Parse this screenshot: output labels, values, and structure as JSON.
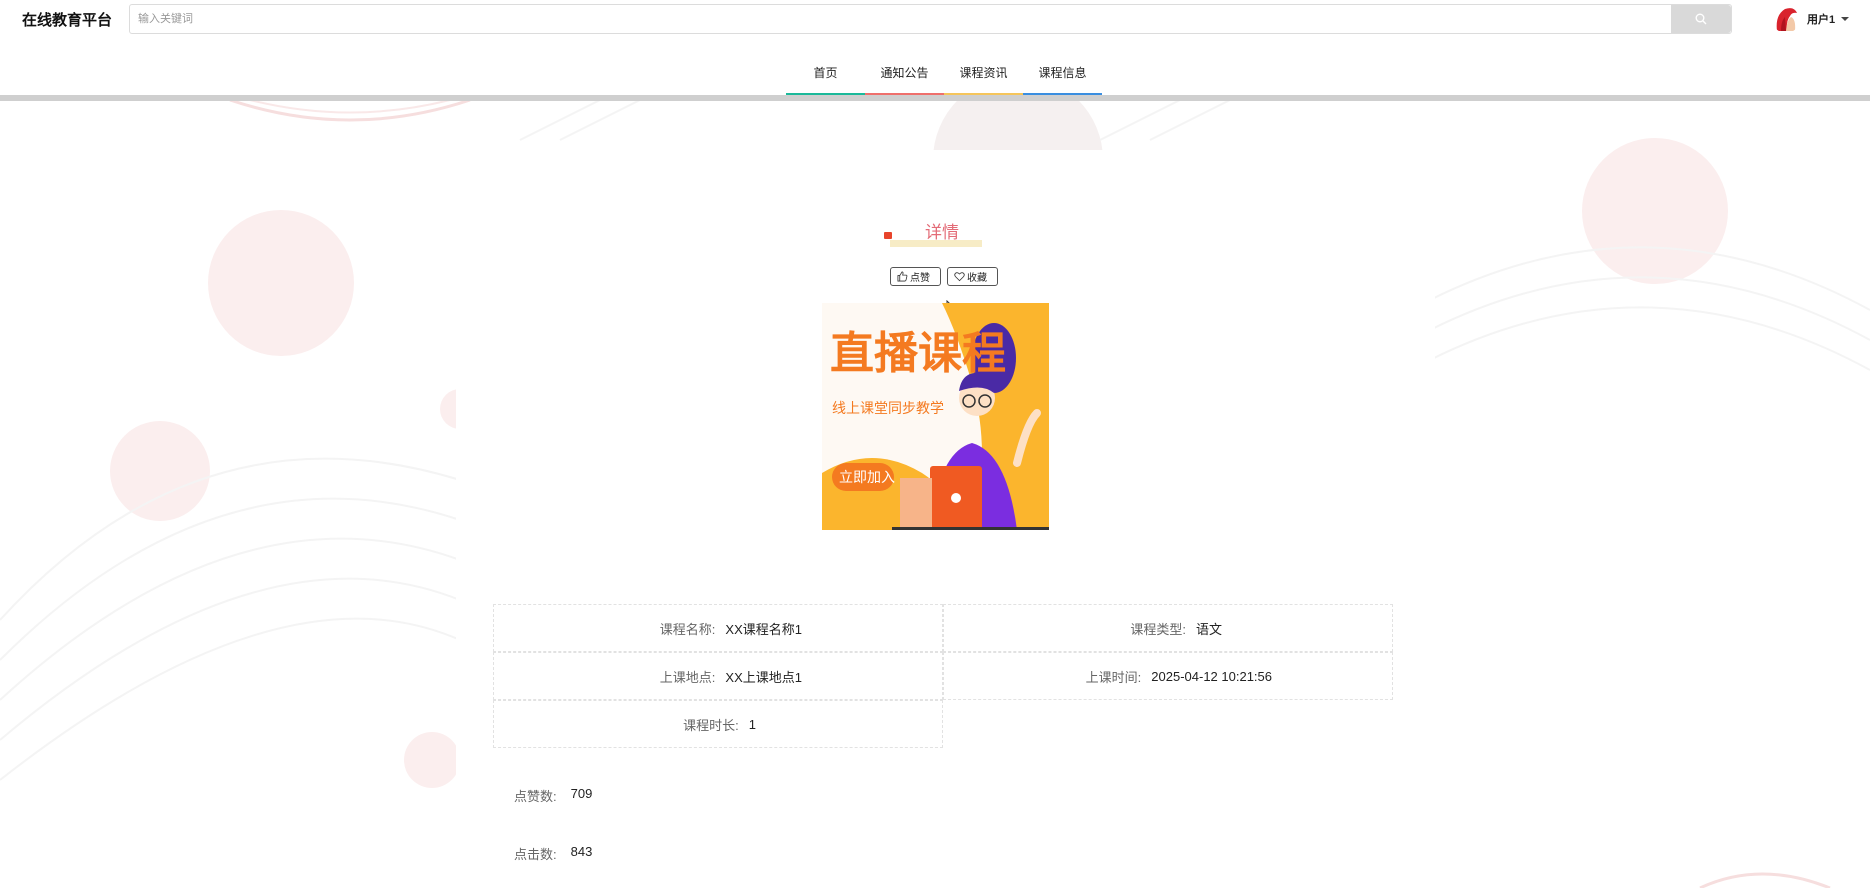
{
  "header": {
    "brand": "在线教育平台",
    "search_placeholder": "输入关键词",
    "search_value": "",
    "user_name": "用户1"
  },
  "nav": {
    "items": [
      {
        "label": "首页",
        "color": "#1bb99a"
      },
      {
        "label": "通知公告",
        "color": "#ef6f6c"
      },
      {
        "label": "课程资讯",
        "color": "#f5c55b"
      },
      {
        "label": "课程信息",
        "color": "#3a8ee0"
      }
    ]
  },
  "detail": {
    "title": "详情",
    "like_label": "点赞",
    "collect_label": "收藏"
  },
  "poster": {
    "heading": "直播课程",
    "subheading": "线上课堂同步教学",
    "cta": "立即加入",
    "bg_color": "#fbb52d",
    "accent_color": "#f47a20"
  },
  "fields": {
    "course_name_label": "课程名称:",
    "course_name": "XX课程名称1",
    "course_type_label": "课程类型:",
    "course_type": "语文",
    "location_label": "上课地点:",
    "location": "XX上课地点1",
    "time_label": "上课时间:",
    "time": "2025-04-12 10:21:56",
    "duration_label": "课程时长:",
    "duration": "1"
  },
  "stats": {
    "likes_label": "点赞数:",
    "likes": "709",
    "clicks_label": "点击数:",
    "clicks": "843"
  },
  "colors": {
    "title": "#e36b77",
    "divider": "#cfcfcf",
    "deco": "#f8e6e6"
  }
}
